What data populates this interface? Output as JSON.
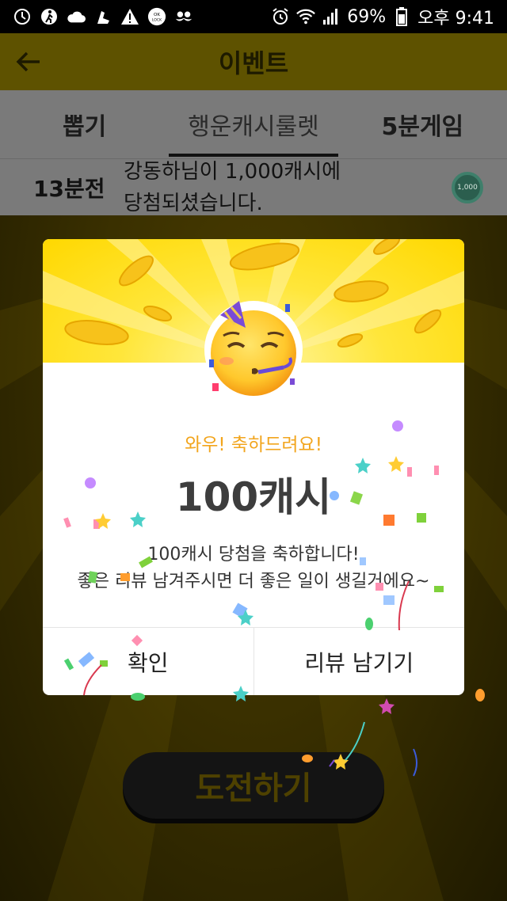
{
  "status_bar": {
    "battery": "69%",
    "time": "오후 9:41"
  },
  "app_bar": {
    "title": "이벤트"
  },
  "tabs": [
    {
      "label": "뽑기"
    },
    {
      "label": "행운캐시룰렛"
    },
    {
      "label": "5분게임"
    }
  ],
  "ticker": {
    "time": "13분전",
    "line1": "강동하님이 1,000캐시에",
    "line2": "당첨되셨습니다.",
    "coin_label": "1,000"
  },
  "modal": {
    "congrats": "와우! 축하드려요!",
    "amount": "100캐시",
    "desc_line1": "100캐시 당첨을 축하합니다!",
    "desc_line2": "좋은 리뷰 남겨주시면 더 좋은 일이 생길거에요~",
    "confirm_label": "확인",
    "review_label": "리뷰 남기기"
  },
  "challenge": {
    "label": "도전하기"
  },
  "colors": {
    "accent_yellow": "#ffe000",
    "congrats_orange": "#f2a51d"
  }
}
